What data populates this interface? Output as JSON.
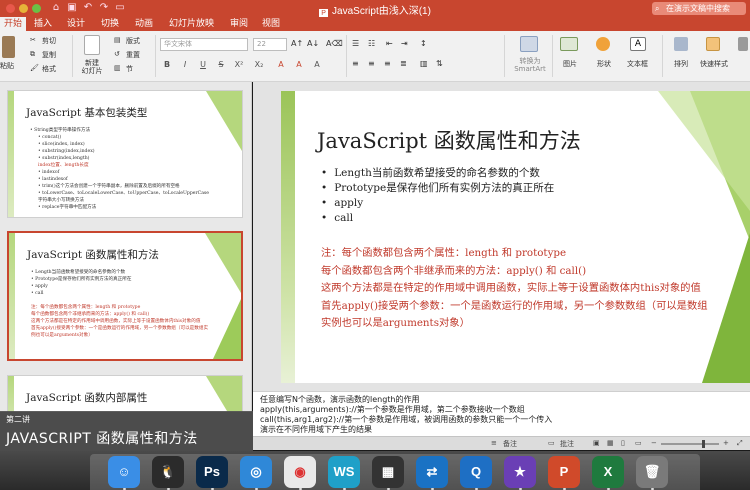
{
  "window": {
    "title": "JavaScript由浅入深(1)",
    "search_placeholder": "在演示文稿中搜索"
  },
  "tabs": [
    "开始",
    "插入",
    "设计",
    "切换",
    "动画",
    "幻灯片放映",
    "审阅",
    "视图"
  ],
  "ribbon": {
    "paste": "粘贴",
    "cut": "剪切",
    "copy": "复制",
    "format": "格式",
    "new_slide": "新建\n幻灯片",
    "layout": "版式",
    "reset": "重置",
    "section": "节",
    "font_name": "华文宋体",
    "font_size": "22",
    "smartart": "转换为\nSmartArt",
    "picture": "图片",
    "shape": "形状",
    "textbox": "文本框",
    "arrange": "排列",
    "quick_styles": "快速样式"
  },
  "thumbnails": [
    {
      "number": "",
      "title": "JavaScript 基本包装类型",
      "lines": [
        {
          "text": "• String类型字符串操作方法",
          "style": ""
        },
        {
          "text": "• concat()",
          "style": "sub"
        },
        {
          "text": "• slice(index, index)",
          "style": "sub"
        },
        {
          "text": "• substring(index,index)",
          "style": "sub"
        },
        {
          "text": "• substr(index,length)",
          "style": "sub"
        },
        {
          "text": "index位置、length长度",
          "style": "sub red"
        },
        {
          "text": "• indexof",
          "style": "sub"
        },
        {
          "text": "• lastindexof",
          "style": "sub"
        },
        {
          "text": "• trim()这个方法会创建一个字符串副本，删除前置及后缀的所有空格",
          "style": "sub"
        },
        {
          "text": "• toLowerCase、toLocaleLowerCase、toUpperCase、toLocaleUpperCase 字符串大小写转换方法",
          "style": "sub"
        },
        {
          "text": "• replace字符串中匹配方法",
          "style": "sub"
        }
      ]
    },
    {
      "number": "",
      "title": "JavaScript 函数属性和方法",
      "lines": [
        {
          "text": "• Length当前函数希望接受的命名参数的个数",
          "style": ""
        },
        {
          "text": "• Prototype是保存他们所有实例方法的真正所在",
          "style": ""
        },
        {
          "text": "• apply",
          "style": ""
        },
        {
          "text": "• call",
          "style": ""
        },
        {
          "text": "",
          "style": ""
        },
        {
          "text": "注：每个函数都包含两个属性：length 和 prototype",
          "style": "red"
        },
        {
          "text": "每个函数都包含两个非继承而来的方法：apply() 和 call()",
          "style": "red"
        },
        {
          "text": "这两个方法都是在特定的作用域中调用函数，实际上等于设置函数体内this对象的值",
          "style": "red"
        },
        {
          "text": "首先apply()接受两个参数：一个是函数运行的作用域，另一个参数数组（可以是数组实例也可以是arguments对象）",
          "style": "red"
        }
      ]
    },
    {
      "number": "",
      "title": "JavaScript 函数内部属性",
      "lines": []
    }
  ],
  "main_slide": {
    "title": "JavaScript 函数属性和方法",
    "bullets": [
      "Length当前函数希望接受的命名参数的个数",
      "Prototype是保存他们所有实例方法的真正所在",
      "apply",
      "call"
    ],
    "notes": [
      "注：每个函数都包含两个属性：length 和 prototype",
      "每个函数都包含两个非继承而来的方法：apply() 和 call()",
      "这两个方法都是在特定的作用域中调用函数，实际上等于设置函数体内this对象的值",
      "首先apply()接受两个参数：一个是函数运行的作用域，另一个参数数组（可以是数组",
      "实例也可以是arguments对象）"
    ]
  },
  "speaker_notes": [
    "任意编写N个函数，演示函数的length的作用",
    "apply(this,arguments)://第一个参数是作用域，第二个参数接收一个数组",
    "call(this,arg1,arg2)://第一个参数是作用域，被调用函数的参数只能一个一个传入",
    "演示在不同作用域下产生的结果"
  ],
  "status": {
    "notes": "备注",
    "comments": "批注",
    "zoom_level": 0.72
  },
  "caption": {
    "label": "第二讲",
    "title": "JAVASCRIPT 函数属性和方法"
  },
  "dock": [
    {
      "name": "finder-app",
      "glyph": "☺",
      "bg": "#3a8ee6"
    },
    {
      "name": "qq-app",
      "glyph": "🐧",
      "bg": "#2b2b2b"
    },
    {
      "name": "photoshop-app",
      "glyph": "Ps",
      "bg": "#0a2a4a"
    },
    {
      "name": "safari-app",
      "glyph": "◎",
      "bg": "#2f88d8"
    },
    {
      "name": "chrome-app",
      "glyph": "◉",
      "bg": "#e9e9e9"
    },
    {
      "name": "webstorm-app",
      "glyph": "WS",
      "bg": "#1fa0c8"
    },
    {
      "name": "video-app",
      "glyph": "▦",
      "bg": "#333333"
    },
    {
      "name": "teamviewer-app",
      "glyph": "⇄",
      "bg": "#1a72c4"
    },
    {
      "name": "quicktime-app",
      "glyph": "Q",
      "bg": "#1e6fc4"
    },
    {
      "name": "imovie-app",
      "glyph": "★",
      "bg": "#6a3fb5"
    },
    {
      "name": "powerpoint-app",
      "glyph": "P",
      "bg": "#d04a2a"
    },
    {
      "name": "excel-app",
      "glyph": "X",
      "bg": "#1f7a3e"
    },
    {
      "name": "trash-app",
      "glyph": "🗑",
      "bg": "#7a7a7a"
    }
  ]
}
